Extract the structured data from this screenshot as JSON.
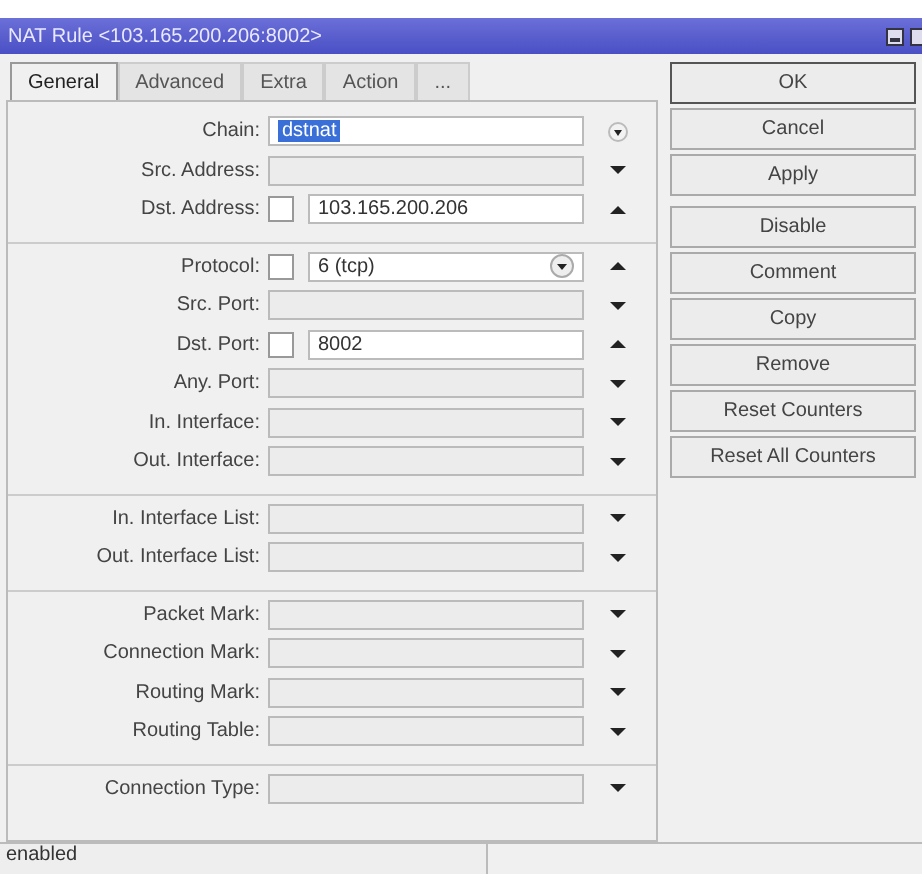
{
  "window": {
    "title": "NAT Rule <103.165.200.206:8002>"
  },
  "tabs": [
    {
      "label": "General",
      "selected": true
    },
    {
      "label": "Advanced",
      "selected": false
    },
    {
      "label": "Extra",
      "selected": false
    },
    {
      "label": "Action",
      "selected": false
    },
    {
      "label": "...",
      "selected": false
    }
  ],
  "groups": [
    [
      {
        "label": "Chain:",
        "kind": "combo",
        "value": "dstnat",
        "value_selected": true
      },
      {
        "label": "Src. Address:",
        "kind": "dropdown"
      },
      {
        "label": "Dst. Address:",
        "kind": "negatable",
        "value": "103.165.200.206",
        "negated": false
      }
    ],
    [
      {
        "label": "Protocol:",
        "kind": "negatable-combo",
        "value": "6 (tcp)",
        "negated": false
      },
      {
        "label": "Src. Port:",
        "kind": "dropdown"
      },
      {
        "label": "Dst. Port:",
        "kind": "negatable",
        "value": "8002",
        "negated": false
      },
      {
        "label": "Any. Port:",
        "kind": "dropdown"
      },
      {
        "label": "In. Interface:",
        "kind": "dropdown"
      },
      {
        "label": "Out. Interface:",
        "kind": "dropdown"
      }
    ],
    [
      {
        "label": "In. Interface List:",
        "kind": "dropdown"
      },
      {
        "label": "Out. Interface List:",
        "kind": "dropdown"
      }
    ],
    [
      {
        "label": "Packet Mark:",
        "kind": "dropdown"
      },
      {
        "label": "Connection Mark:",
        "kind": "dropdown"
      },
      {
        "label": "Routing Mark:",
        "kind": "dropdown"
      },
      {
        "label": "Routing Table:",
        "kind": "dropdown"
      }
    ],
    [
      {
        "label": "Connection Type:",
        "kind": "dropdown"
      }
    ]
  ],
  "buttons": [
    "OK",
    "Cancel",
    "Apply",
    "Disable",
    "Comment",
    "Copy",
    "Remove",
    "Reset Counters",
    "Reset All Counters"
  ],
  "status_bar": "enabled"
}
